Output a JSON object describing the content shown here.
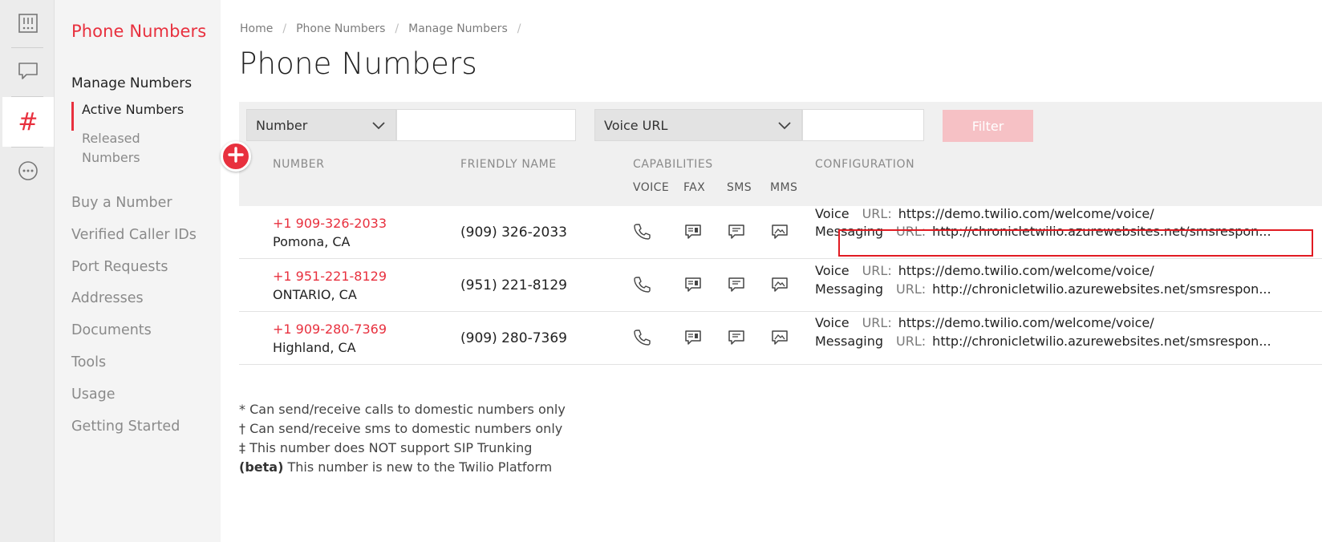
{
  "rail": {
    "items": [
      {
        "icon": "dashboard-icon"
      },
      {
        "icon": "chat-icon"
      },
      {
        "icon": "hash-icon",
        "glyph": "#",
        "active": true
      },
      {
        "icon": "more-icon"
      }
    ]
  },
  "nav": {
    "title": "Phone Numbers",
    "section": "Manage Numbers",
    "sub_items": [
      "Active Numbers",
      "Released Numbers"
    ],
    "links": [
      "Buy a Number",
      "Verified Caller IDs",
      "Port Requests",
      "Addresses",
      "Documents",
      "Tools",
      "Usage",
      "Getting Started"
    ]
  },
  "breadcrumb": [
    "Home",
    "Phone Numbers",
    "Manage Numbers"
  ],
  "breadcrumb_sep": "/",
  "page_title": "Phone Numbers",
  "filters": {
    "field1": "Number",
    "field2": "Voice URL",
    "button": "Filter"
  },
  "table": {
    "headers": {
      "number": "NUMBER",
      "friendly_name": "FRIENDLY NAME",
      "capabilities": "CAPABILITIES",
      "configuration": "CONFIGURATION"
    },
    "capability_headers": [
      "VOICE",
      "FAX",
      "SMS",
      "MMS"
    ],
    "url_label": "URL:",
    "voice_label": "Voice",
    "messaging_label": "Messaging",
    "rows": [
      {
        "number": "+1 909-326-2033",
        "location": "Pomona, CA",
        "friendly_name": "(909) 326-2033",
        "voice_url": "https://demo.twilio.com/welcome/voice/",
        "messaging_url": "http://chronicletwilio.azurewebsites.net/smsrespon..."
      },
      {
        "number": "+1 951-221-8129",
        "location": "ONTARIO, CA",
        "friendly_name": "(951) 221-8129",
        "voice_url": "https://demo.twilio.com/welcome/voice/",
        "messaging_url": "http://chronicletwilio.azurewebsites.net/smsrespon..."
      },
      {
        "number": "+1 909-280-7369",
        "location": "Highland, CA",
        "friendly_name": "(909) 280-7369",
        "voice_url": "https://demo.twilio.com/welcome/voice/",
        "messaging_url": "http://chronicletwilio.azurewebsites.net/smsrespon..."
      }
    ]
  },
  "notes": [
    {
      "mark": "*",
      "text": "Can send/receive calls to domestic numbers only"
    },
    {
      "mark": "†",
      "text": "Can send/receive sms to domestic numbers only"
    },
    {
      "mark": "‡",
      "text": "This number does NOT support SIP Trunking"
    },
    {
      "mark": "(beta)",
      "text": "This number is new to the Twilio Platform"
    }
  ],
  "colors": {
    "accent": "#e8303e",
    "highlight_box": "#e11b22",
    "filter_button_disabled": "#f6c1c5"
  }
}
